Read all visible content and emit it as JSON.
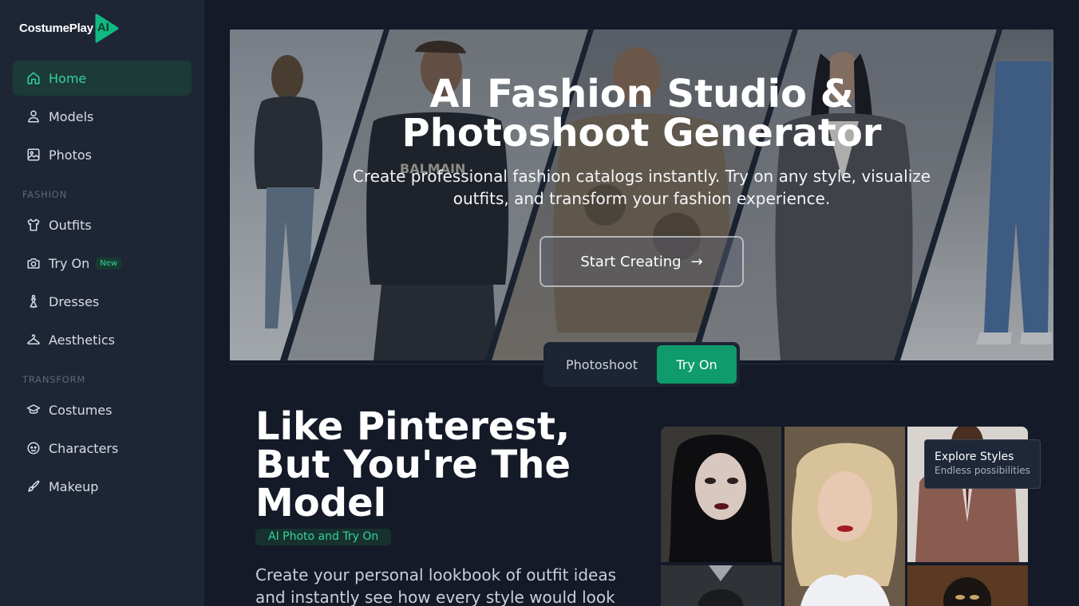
{
  "brand": {
    "name": "CostumePlay",
    "badge": "AI",
    "color": "#10b981"
  },
  "sidebar": {
    "items": [
      {
        "label": "Home",
        "icon": "home-icon",
        "active": true
      },
      {
        "label": "Models",
        "icon": "person-icon"
      },
      {
        "label": "Photos",
        "icon": "image-icon"
      },
      {
        "label": "Outfits",
        "icon": "tshirt-icon"
      },
      {
        "label": "Try On",
        "icon": "camera-icon",
        "badge": "New"
      },
      {
        "label": "Dresses",
        "icon": "dress-icon"
      },
      {
        "label": "Aesthetics",
        "icon": "hanger-icon"
      },
      {
        "label": "Costumes",
        "icon": "graduation-cap-icon"
      },
      {
        "label": "Characters",
        "icon": "character-face-icon"
      },
      {
        "label": "Makeup",
        "icon": "brush-icon"
      }
    ],
    "sections": {
      "fashion": "FASHION",
      "transform": "TRANSFORM"
    }
  },
  "hero": {
    "title_line1": "AI Fashion Studio &",
    "title_line2": "Photoshoot Generator",
    "subtitle": "Create professional fashion catalogs instantly. Try on any style, visualize outfits, and transform your fashion experience.",
    "cta": "Start Creating",
    "cta_arrow": "→",
    "images": [
      "model-back-view-photo",
      "model-balmain-tee-photo",
      "model-embroidered-jacket-photo",
      "model-gray-blazer-photo",
      "model-jeans-photo"
    ]
  },
  "mode_toggle": {
    "photoshoot": "Photoshoot",
    "tryon": "Try On",
    "selected": "Try On"
  },
  "section2": {
    "title": "Like Pinterest, But You're The Model",
    "tag": "AI Photo and Try On",
    "description": "Create your personal lookbook of outfit ideas and instantly see how every style would look",
    "tooltip_title": "Explore Styles",
    "tooltip_subtitle": "Endless possibilities"
  },
  "colors": {
    "accent": "#10b981",
    "accent_text": "#34d399",
    "background": "#141a28",
    "sidebar": "#1e2635"
  }
}
